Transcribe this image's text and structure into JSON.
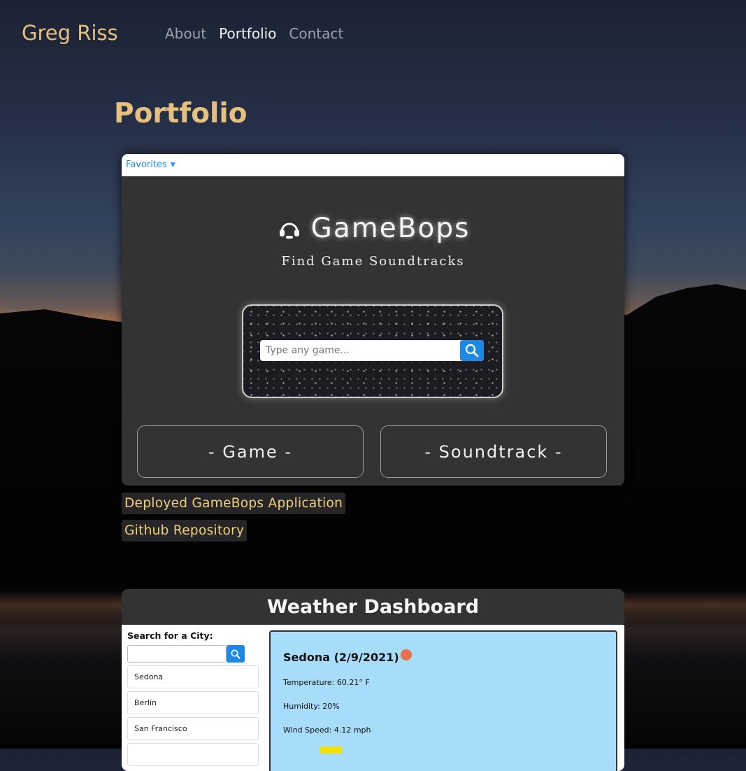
{
  "site": {
    "name": "Greg Riss",
    "nav": [
      "About",
      "Portfolio",
      "Contact"
    ],
    "active_nav": "Portfolio"
  },
  "page": {
    "title": "Portfolio"
  },
  "project1": {
    "favorites_label": "Favorites",
    "app_title": "GameBops",
    "app_subtitle": "Find Game Soundtracks",
    "search_placeholder": "Type any game...",
    "game_button": "- Game -",
    "soundtrack_button": "- Soundtrack -",
    "deployed_link": "Deployed GameBops Application",
    "repo_link": "Github Repository",
    "icon": "headphones-icon"
  },
  "project2": {
    "title": "Weather Dashboard",
    "search_label": "Search for a City:",
    "cities": [
      "Sedona",
      "Berlin",
      "San Francisco"
    ],
    "current_city": "Sedona (2/9/2021)",
    "temperature": "Temperature: 60.21° F",
    "humidity": "Humidity: 20%",
    "wind": "Wind Speed: 4.12 mph"
  },
  "colors": {
    "accent": "#e8c07e",
    "link_text": "#f3cf7a",
    "search_blue": "#1e88e5",
    "weather_panel": "#a7dcfb"
  }
}
